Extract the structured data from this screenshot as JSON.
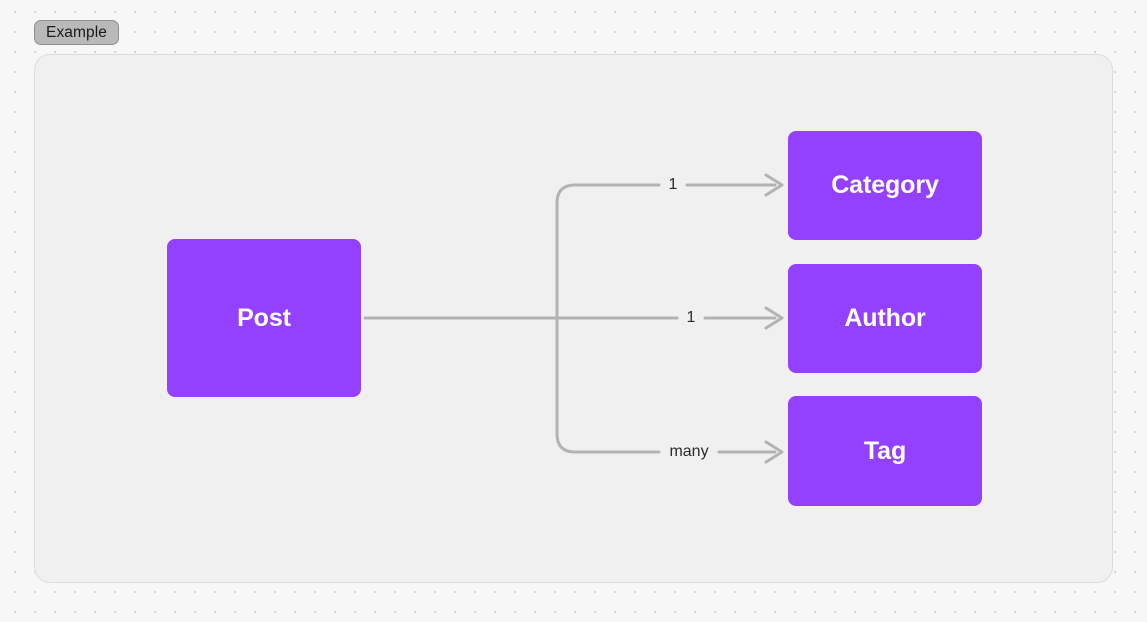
{
  "group": {
    "label": "Example"
  },
  "colors": {
    "canvas_bg": "#f7f7f7",
    "grid_dot": "#d8d8d8",
    "group_bg": "#f0f0f0",
    "group_border": "#dcdcdc",
    "label_pill_bg": "#b9b9b9",
    "label_pill_border": "#8f8f8f",
    "node_fill": "#9441ff",
    "node_text": "#ffffff",
    "edge_stroke": "#b3b3b3",
    "edge_label_text": "#2b2b2b"
  },
  "nodes": [
    {
      "id": "post",
      "label": "Post"
    },
    {
      "id": "category",
      "label": "Category"
    },
    {
      "id": "author",
      "label": "Author"
    },
    {
      "id": "tag",
      "label": "Tag"
    }
  ],
  "edges": [
    {
      "from": "post",
      "to": "category",
      "label": "1"
    },
    {
      "from": "post",
      "to": "author",
      "label": "1"
    },
    {
      "from": "post",
      "to": "tag",
      "label": "many"
    }
  ],
  "diagram_data": {
    "type": "diagram",
    "layout": "left-to-right-tree",
    "title": "Example",
    "nodes": [
      "Post",
      "Category",
      "Author",
      "Tag"
    ],
    "relationships": [
      {
        "source": "Post",
        "target": "Category",
        "cardinality": "1"
      },
      {
        "source": "Post",
        "target": "Author",
        "cardinality": "1"
      },
      {
        "source": "Post",
        "target": "Tag",
        "cardinality": "many"
      }
    ]
  }
}
